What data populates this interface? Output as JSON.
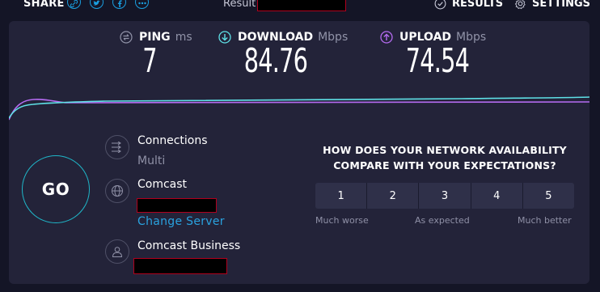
{
  "header": {
    "share_label": "SHARE",
    "share_icons": [
      "link-icon",
      "twitter-icon",
      "facebook-icon",
      "more-icon"
    ],
    "result_label": "Result",
    "results_label": "RESULTS",
    "settings_label": "SETTINGS"
  },
  "metrics": {
    "ping": {
      "label": "PING",
      "unit": "ms",
      "value": "7"
    },
    "download": {
      "label": "DOWNLOAD",
      "unit": "Mbps",
      "value": "84.76"
    },
    "upload": {
      "label": "UPLOAD",
      "unit": "Mbps",
      "value": "74.54"
    }
  },
  "go_label": "GO",
  "connections": {
    "title": "Connections",
    "value": "Multi"
  },
  "server": {
    "title": "Comcast",
    "change_label": "Change Server"
  },
  "provider": {
    "title": "Comcast Business"
  },
  "survey": {
    "question": "HOW DOES YOUR NETWORK AVAILABILITY COMPARE WITH YOUR EXPECTATIONS?",
    "options": [
      "1",
      "2",
      "3",
      "4",
      "5"
    ],
    "low_label": "Much worse",
    "mid_label": "As expected",
    "high_label": "Much better"
  },
  "colors": {
    "background": "#141526",
    "panel": "#232339",
    "accent_blue": "#1a9fe0",
    "download_cyan": "#5ee0e6",
    "upload_purple": "#b46bf0"
  }
}
